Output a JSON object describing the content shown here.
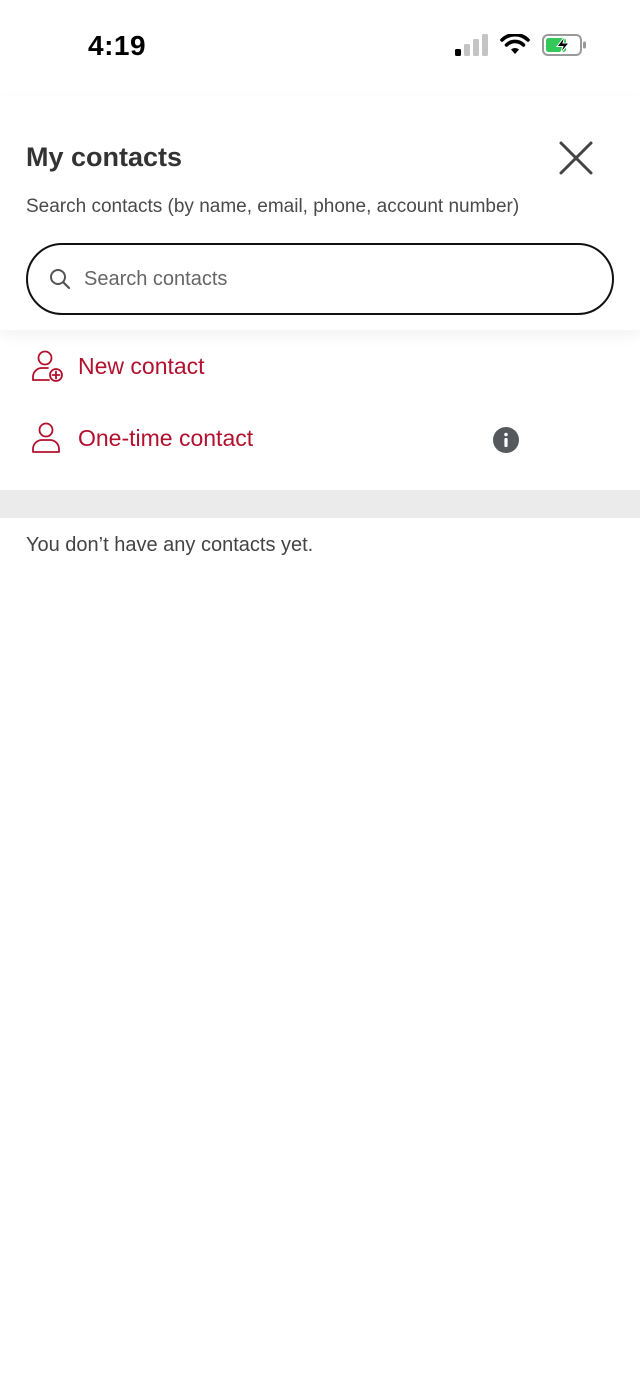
{
  "status_bar": {
    "time": "4:19",
    "icons": [
      "signal-icon",
      "wifi-icon",
      "battery-charging-icon"
    ]
  },
  "header": {
    "title": "My contacts",
    "subtitle": "Search contacts (by name, email, phone, account number)",
    "close_icon": "close-icon"
  },
  "search": {
    "placeholder": "Search contacts",
    "value": "",
    "icon": "search-icon"
  },
  "actions": [
    {
      "label": "New contact",
      "icon": "add-person-icon"
    },
    {
      "label": "One-time contact",
      "icon": "person-icon",
      "info_icon": "info-icon"
    }
  ],
  "empty_state": {
    "message": "You don’t have any contacts yet."
  },
  "colors": {
    "accent": "#b3102e",
    "divider": "#ebebeb",
    "text": "#333333",
    "battery_fill": "#34c759"
  }
}
